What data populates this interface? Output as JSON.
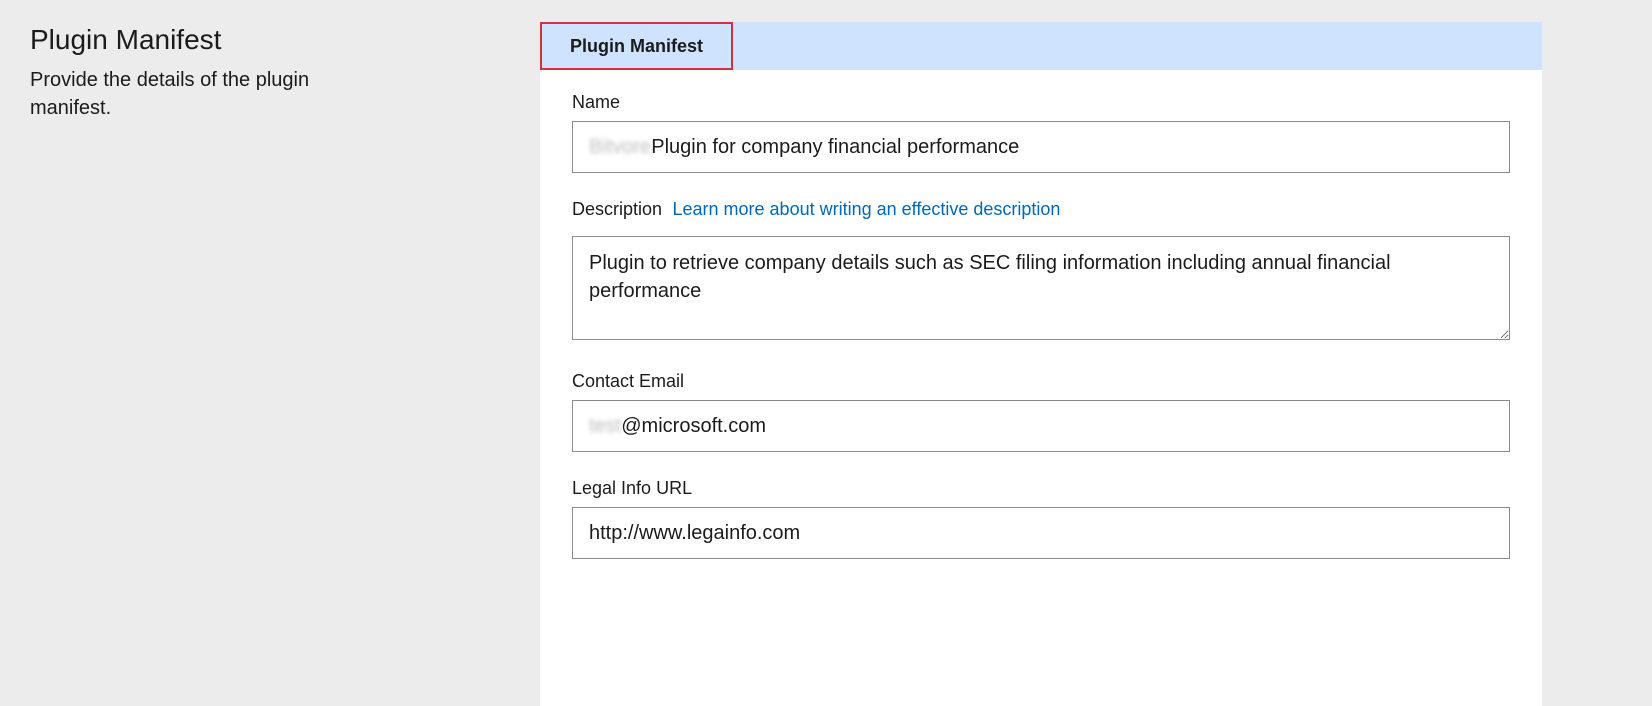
{
  "sidebar": {
    "title": "Plugin Manifest",
    "subtitle": "Provide the details of the plugin manifest."
  },
  "tabs": [
    {
      "label": "Plugin Manifest",
      "active": true
    }
  ],
  "form": {
    "name": {
      "label": "Name",
      "blurred_prefix": "Bitvore",
      "value": " Plugin for company financial performance"
    },
    "description": {
      "label": "Description",
      "help_link_text": "Learn more about writing an effective description",
      "value": "Plugin to retrieve company details such as SEC filing information including annual financial performance"
    },
    "contact_email": {
      "label": "Contact Email",
      "blurred_prefix": "test",
      "value": "@microsoft.com"
    },
    "legal_info_url": {
      "label": "Legal Info URL",
      "value": "http://www.legainfo.com"
    }
  }
}
